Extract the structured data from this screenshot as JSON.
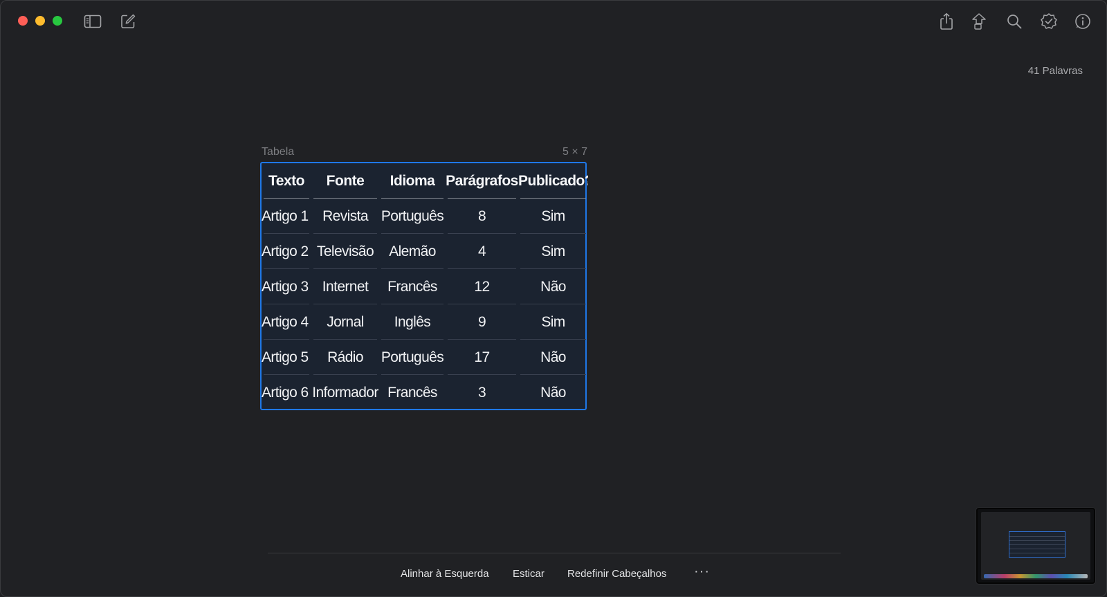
{
  "window": {
    "word_count": "41 Palavras"
  },
  "toolbar": {
    "icons": [
      "sidebar-toggle-icon",
      "compose-icon",
      "share-icon",
      "lock-share-icon",
      "search-icon",
      "checklist-badge-icon",
      "info-icon"
    ]
  },
  "table": {
    "label": "Tabela",
    "dimensions": "5 × 7",
    "headers": [
      "Texto",
      "Fonte",
      "Idioma",
      "Parágrafos",
      "Publicado?"
    ],
    "rows": [
      [
        "Artigo 1",
        "Revista",
        "Português",
        "8",
        "Sim"
      ],
      [
        "Artigo 2",
        "Televisão",
        "Alemão",
        "4",
        "Sim"
      ],
      [
        "Artigo 3",
        "Internet",
        "Francês",
        "12",
        "Não"
      ],
      [
        "Artigo 4",
        "Jornal",
        "Inglês",
        "9",
        "Sim"
      ],
      [
        "Artigo 5",
        "Rádio",
        "Português",
        "17",
        "Não"
      ],
      [
        "Artigo 6",
        "Informador",
        "Francês",
        "3",
        "Não"
      ]
    ],
    "accent_color": "#1f78e8"
  },
  "bottom_bar": {
    "align_left": "Alinhar à Esquerda",
    "stretch": "Esticar",
    "reset_headers": "Redefinir Cabeçalhos",
    "more": "···"
  }
}
